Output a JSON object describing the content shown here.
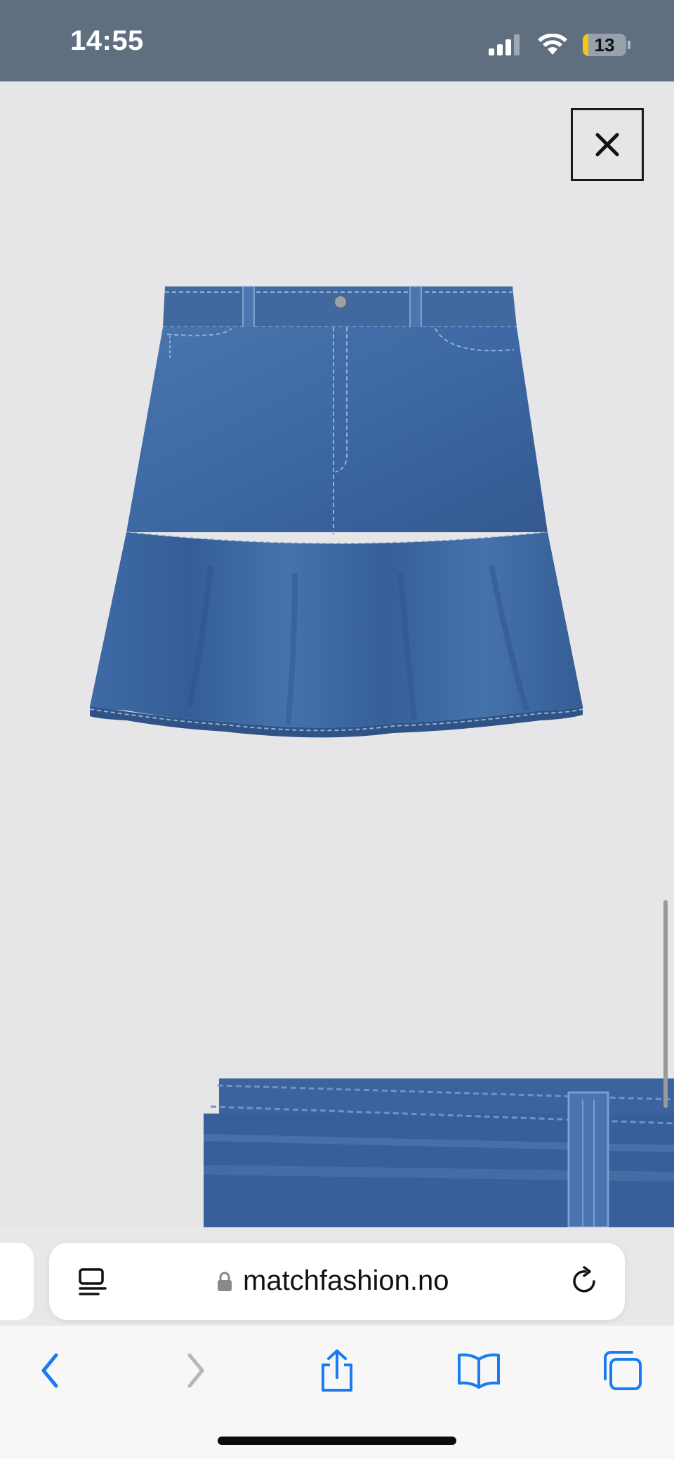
{
  "status_bar": {
    "time": "14:55",
    "battery_level": "13",
    "battery_fraction": 0.13,
    "icons": [
      "signal-icon",
      "wifi-icon",
      "battery-icon"
    ]
  },
  "content": {
    "close_icon": "close-icon",
    "product_image": "denim-skirt-image",
    "detail_image": "denim-waistband-detail-image"
  },
  "address_bar": {
    "reader_icon": "reader-mode-icon",
    "url": "matchfashion.no",
    "lock_icon": "lock-icon",
    "reload_icon": "reload-icon"
  },
  "toolbar": {
    "items": [
      "back-icon",
      "forward-icon",
      "share-icon",
      "bookmarks-icon",
      "tabs-icon"
    ]
  },
  "colors": {
    "status_bar": "#5f6f80",
    "page_background": "#e6e6e8",
    "accent": "#1a7cf0",
    "denim": "#3f6aa6"
  }
}
